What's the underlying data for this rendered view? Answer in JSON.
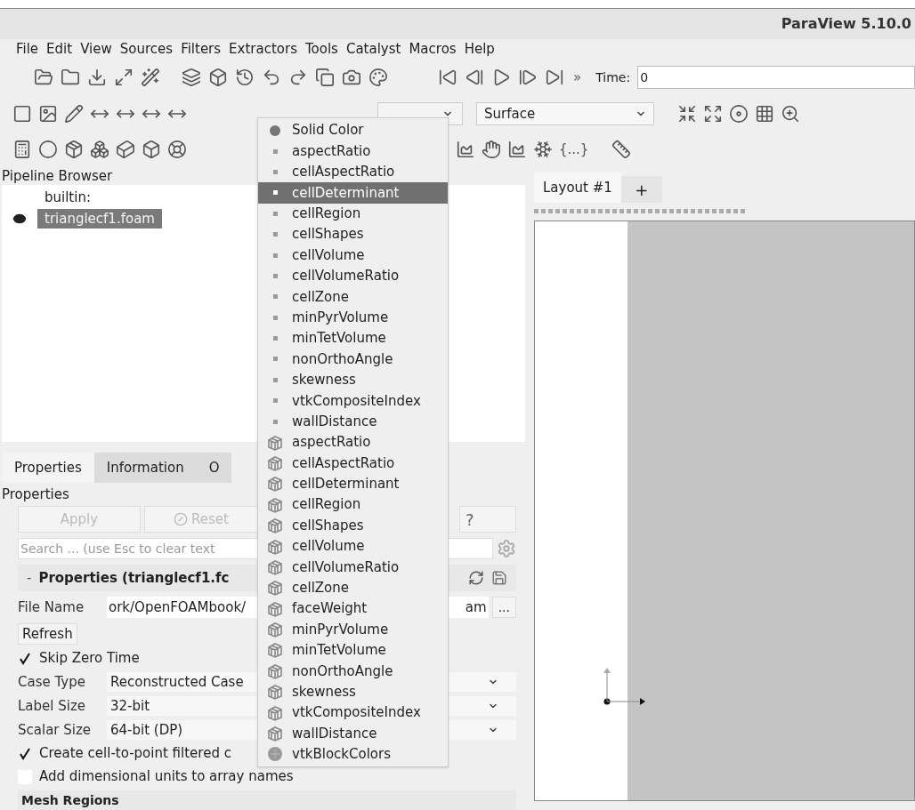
{
  "window": {
    "title": "ParaView 5.10.0"
  },
  "menu": [
    "File",
    "Edit",
    "View",
    "Sources",
    "Filters",
    "Extractors",
    "Tools",
    "Catalyst",
    "Macros",
    "Help"
  ],
  "toolbar": {
    "more": "»",
    "time_label": "Time:",
    "time_value": "0",
    "representation": "Surface",
    "braces": "{...}"
  },
  "pipeline": {
    "title": "Pipeline Browser",
    "items": [
      {
        "label": "builtin:",
        "children": [
          {
            "label": "trianglecf1.foam",
            "selected": true,
            "visible": true
          }
        ]
      }
    ]
  },
  "properties_tabs": [
    {
      "label": "Properties",
      "selected": true
    },
    {
      "label": "Information",
      "selected": false
    },
    {
      "label": "O",
      "selected": false
    }
  ],
  "properties": {
    "title": "Properties",
    "apply": {
      "label": "Apply",
      "disabled": true
    },
    "reset": {
      "label": "Reset",
      "disabled": true
    },
    "help": "?",
    "search_placeholder": "Search ... (use Esc to clear text",
    "section": "Properties (trianglecf1.fc",
    "section_toggle": "-",
    "file_name": {
      "label": "File Name",
      "value_left": "ork/OpenFOAMbook/",
      "value_right": "am",
      "browse": "..."
    },
    "refresh": "Refresh",
    "rows": [
      {
        "kind": "check",
        "label": "Skip Zero Time",
        "checked": true
      },
      {
        "kind": "combo",
        "label": "Case Type",
        "value": "Reconstructed Case"
      },
      {
        "kind": "combo",
        "label": "Label Size",
        "value": "32-bit"
      },
      {
        "kind": "combo",
        "label": "Scalar Size",
        "value": "64-bit (DP)"
      },
      {
        "kind": "check",
        "label": "Create cell-to-point filtered c",
        "checked": true
      },
      {
        "kind": "check",
        "label": "Add dimensional units to array names",
        "checked": false
      }
    ],
    "mesh_regions": "Mesh Regions"
  },
  "layout": {
    "tab": "Layout #1",
    "add": "+"
  },
  "color_menu": [
    {
      "kind": "solid",
      "label": "Solid Color",
      "selected": false
    },
    {
      "kind": "point",
      "label": "aspectRatio",
      "selected": false
    },
    {
      "kind": "point",
      "label": "cellAspectRatio",
      "selected": false
    },
    {
      "kind": "point",
      "label": "cellDeterminant",
      "selected": true
    },
    {
      "kind": "point",
      "label": "cellRegion",
      "selected": false
    },
    {
      "kind": "point",
      "label": "cellShapes",
      "selected": false
    },
    {
      "kind": "point",
      "label": "cellVolume",
      "selected": false
    },
    {
      "kind": "point",
      "label": "cellVolumeRatio",
      "selected": false
    },
    {
      "kind": "point",
      "label": "cellZone",
      "selected": false
    },
    {
      "kind": "point",
      "label": "minPyrVolume",
      "selected": false
    },
    {
      "kind": "point",
      "label": "minTetVolume",
      "selected": false
    },
    {
      "kind": "point",
      "label": "nonOrthoAngle",
      "selected": false
    },
    {
      "kind": "point",
      "label": "skewness",
      "selected": false
    },
    {
      "kind": "point",
      "label": "vtkCompositeIndex",
      "selected": false
    },
    {
      "kind": "point",
      "label": "wallDistance",
      "selected": false
    },
    {
      "kind": "cell",
      "label": "aspectRatio",
      "selected": false
    },
    {
      "kind": "cell",
      "label": "cellAspectRatio",
      "selected": false
    },
    {
      "kind": "cell",
      "label": "cellDeterminant",
      "selected": false
    },
    {
      "kind": "cell",
      "label": "cellRegion",
      "selected": false
    },
    {
      "kind": "cell",
      "label": "cellShapes",
      "selected": false
    },
    {
      "kind": "cell",
      "label": "cellVolume",
      "selected": false
    },
    {
      "kind": "cell",
      "label": "cellVolumeRatio",
      "selected": false
    },
    {
      "kind": "cell",
      "label": "cellZone",
      "selected": false
    },
    {
      "kind": "cell",
      "label": "faceWeight",
      "selected": false
    },
    {
      "kind": "cell",
      "label": "minPyrVolume",
      "selected": false
    },
    {
      "kind": "cell",
      "label": "minTetVolume",
      "selected": false
    },
    {
      "kind": "cell",
      "label": "nonOrthoAngle",
      "selected": false
    },
    {
      "kind": "cell",
      "label": "skewness",
      "selected": false
    },
    {
      "kind": "cell",
      "label": "vtkCompositeIndex",
      "selected": false
    },
    {
      "kind": "cell",
      "label": "wallDistance",
      "selected": false
    },
    {
      "kind": "block",
      "label": "vtkBlockColors",
      "selected": false
    }
  ]
}
